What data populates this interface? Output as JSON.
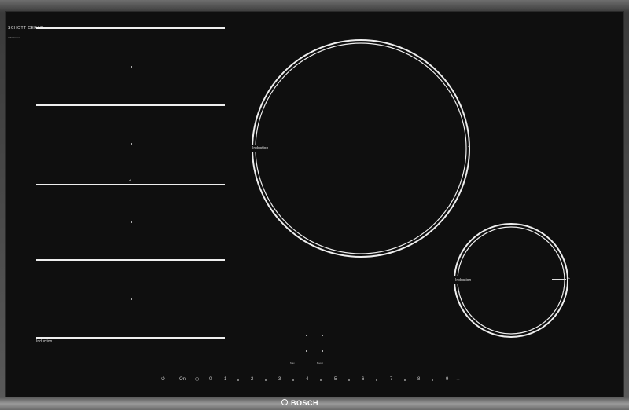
{
  "brand": {
    "glass_maker": "SCHOTT CERAN",
    "glass_maker_sub": "schottceran",
    "logo": "BOSCH"
  },
  "zones": {
    "flex_label": "Induction",
    "large_label": "Induction",
    "small_label": "Induction"
  },
  "controls": {
    "power_icon": "power-icon",
    "on_label": "On",
    "timer_icon": "clock-icon",
    "levels": [
      "0",
      "1",
      "2",
      "3",
      "4",
      "5",
      "6",
      "7",
      "8",
      "9"
    ],
    "boost_icon": "boost-icon"
  },
  "mini_panel": {
    "left": "Max",
    "right": "Boost"
  },
  "colors": {
    "glass": "#0f0f0f",
    "markings": "#eeeeee",
    "frame": "#5a5a5a"
  }
}
